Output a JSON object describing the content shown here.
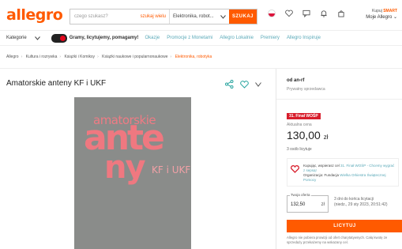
{
  "header": {
    "logo": "allegro",
    "search_placeholder": "czego szukasz?",
    "search_scope": "szukaj wielu",
    "search_category": "Elektronika, robot...",
    "search_button": "SZUKAJ",
    "account_line1": "Kupuj ",
    "account_smart": "SMART",
    "account_line2": "Moje Allegro"
  },
  "nav": {
    "categories_label": "Kategorie",
    "wosp_text": "Gramy, licytujemy, pomagamy!",
    "links": [
      "Okazje",
      "Promocje z Monetami",
      "Allegro Lokalnie",
      "Premiery",
      "Allegro Inspiruje"
    ]
  },
  "breadcrumb": {
    "items": [
      "Allegro",
      "Kultura i rozrywka",
      "Książki i Komiksy",
      "Książki naukowe i popularnonaukowe"
    ],
    "current": "Elektronika, robotyka"
  },
  "product": {
    "title": "Amatorskie anteny KF i UKF",
    "cover": {
      "line1": "amatorskie",
      "line2": "ante",
      "line3": "ny",
      "line4": "KF i UKF"
    }
  },
  "panel": {
    "seller_prefix": "od ",
    "seller_name": "an-rf",
    "seller_type": "Prywatny sprzedawca",
    "badge": "31. Finał WOŚP",
    "price_label": "Aktualna cena",
    "price_value": "130,00",
    "price_currency": "zł",
    "bids": "3 osób licytuje",
    "charity_text": "Kupując, wspierasz cel ",
    "charity_goal": "31. Finał WOŚP - Chcemy wygrać z sepsą!",
    "charity_org_label": "Organizacja: Fundacja ",
    "charity_org": "Wielka Orkiestra Świątecznej Pomocy",
    "offer_label": "Twoja oferta",
    "offer_value": "132,50",
    "offer_unit": "zł",
    "ends_line1": "3 dni do końca licytacji",
    "ends_line2": "(niedz., 29 sty 2023, 20:51:42)",
    "bid_button": "LICYTUJ",
    "note": "Allegro nie pobiera prowizji od ofert charytatywnych. Całą kwotę ze sprzedaży przekażemy na wskazany cel."
  },
  "colors": {
    "brand": "#ff5a00",
    "link": "#5aa9b8",
    "wosp_red": "#d81e2c"
  }
}
